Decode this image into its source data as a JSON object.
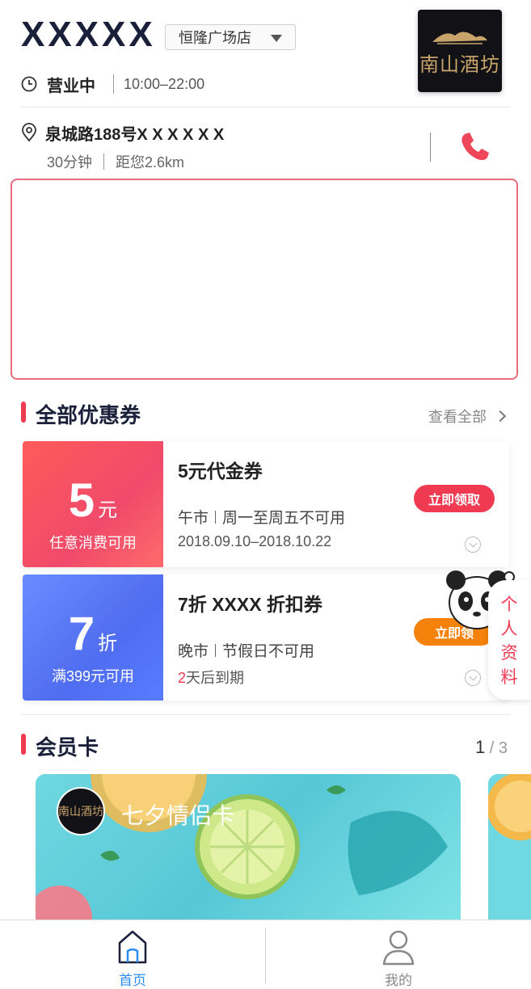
{
  "store": {
    "name": "XXXXX",
    "branch": "恒隆广场店",
    "status": "营业中",
    "hours": "10:00–22:00",
    "address": "泉城路188号X X X X X X",
    "delivery_time": "30分钟",
    "distance": "距您2.6km",
    "logo_text": "南山酒坊"
  },
  "coupons_section": {
    "title": "全部优惠券",
    "view_all": "查看全部"
  },
  "coupons": [
    {
      "amount": "5",
      "unit": "元",
      "condition": "任意消费可用",
      "title": "5元代金券",
      "time_slot": "午市",
      "restriction": "周一至周五不可用",
      "validity": "2018.09.10–2018.10.22",
      "button": "立即领取",
      "color": "#ef3a52"
    },
    {
      "amount": "7",
      "unit": "折",
      "condition": "满399元可用",
      "title": "7折 XXXX 折扣券",
      "time_slot": "晚市",
      "restriction": "节假日不可用",
      "expiry_number": "2",
      "expiry_suffix": "天后到期",
      "button": "立即领",
      "color": "#f5820a"
    }
  ],
  "member_section": {
    "title": "会员卡",
    "page_current": "1",
    "page_total": "3",
    "card_name": "七夕情侣卡",
    "card_logo_text": "南山酒坊"
  },
  "profile_tab": {
    "label": "个人资料"
  },
  "bottom_nav": {
    "home": "首页",
    "mine": "我的"
  },
  "colors": {
    "accent": "#ef3a52",
    "active_nav": "#2d8cf0",
    "title_text": "#1a1f3a"
  }
}
